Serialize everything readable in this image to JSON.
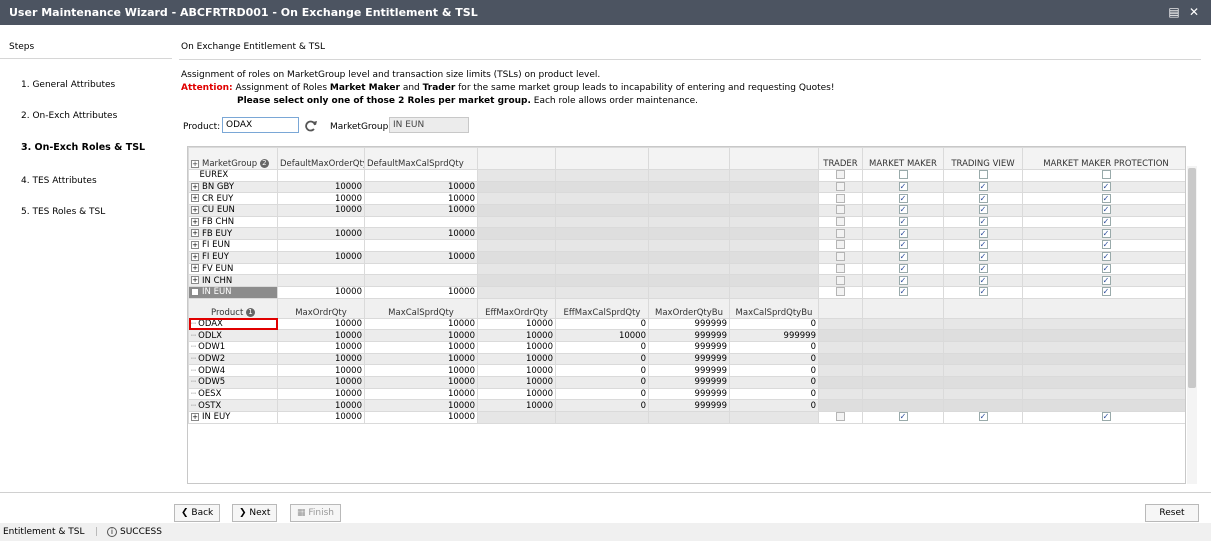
{
  "window": {
    "title": "User Maintenance Wizard  - ABCFRTRD001 - On Exchange Entitlement & TSL"
  },
  "steps": {
    "header": "Steps",
    "items": [
      "1. General Attributes",
      "2. On-Exch Attributes",
      "3. On-Exch Roles & TSL",
      "4. TES Attributes",
      "5. TES Roles & TSL"
    ],
    "active_index": 2
  },
  "section": {
    "title": "On Exchange Entitlement & TSL",
    "info_line1": "Assignment of roles on MarketGroup level and transaction size limits (TSLs) on product level.",
    "attention_label": "Attention:",
    "info_line2_a": "Assignment of Roles ",
    "info_line2_b": "Market Maker",
    "info_line2_c": " and ",
    "info_line2_d": "Trader",
    "info_line2_e": " for the same market group leads to incapability of entering and requesting Quotes!",
    "info_line3_bold": "Please select only one of those 2 Roles per market group.",
    "info_line3_rest": " Each role allows order maintenance."
  },
  "filters": {
    "product_label": "Product:",
    "product_value": "ODAX",
    "marketgroup_label": "MarketGroup:",
    "marketgroup_value": "IN EUN"
  },
  "grid": {
    "headers": [
      "MarketGroup",
      "DefaultMaxOrderQty",
      "DefaultMaxCalSprdQty",
      "",
      "",
      "",
      "",
      "TRADER",
      "MARKET MAKER",
      "TRADING VIEW",
      "MARKET MAKER PROTECTION"
    ],
    "marketgroup_sort_badge": "2",
    "rows_top": [
      {
        "name": "EUREX",
        "q1": "",
        "q2": "",
        "expander": false,
        "roles": [
          false,
          false,
          false,
          false
        ],
        "checks_shown": true
      },
      {
        "name": "BN GBY",
        "q1": "10000",
        "q2": "10000",
        "expander": true,
        "roles": [
          false,
          true,
          true,
          true
        ],
        "checks_shown": true
      },
      {
        "name": "CR EUY",
        "q1": "10000",
        "q2": "10000",
        "expander": true,
        "roles": [
          false,
          true,
          true,
          true
        ],
        "checks_shown": true
      },
      {
        "name": "CU EUN",
        "q1": "10000",
        "q2": "10000",
        "expander": true,
        "roles": [
          false,
          true,
          true,
          true
        ],
        "checks_shown": true
      },
      {
        "name": "FB CHN",
        "q1": "",
        "q2": "",
        "expander": true,
        "roles": [
          false,
          true,
          true,
          true
        ],
        "checks_shown": true
      },
      {
        "name": "FB EUY",
        "q1": "10000",
        "q2": "10000",
        "expander": true,
        "roles": [
          false,
          true,
          true,
          true
        ],
        "checks_shown": true
      },
      {
        "name": "FI EUN",
        "q1": "",
        "q2": "",
        "expander": true,
        "roles": [
          false,
          true,
          true,
          true
        ],
        "checks_shown": true
      },
      {
        "name": "FI EUY",
        "q1": "10000",
        "q2": "10000",
        "expander": true,
        "roles": [
          false,
          true,
          true,
          true
        ],
        "checks_shown": true
      },
      {
        "name": "FV EUN",
        "q1": "",
        "q2": "",
        "expander": true,
        "roles": [
          false,
          true,
          true,
          true
        ],
        "checks_shown": true
      },
      {
        "name": "IN CHN",
        "q1": "",
        "q2": "",
        "expander": true,
        "roles": [
          false,
          true,
          true,
          true
        ],
        "checks_shown": true
      },
      {
        "name": "IN EUN",
        "q1": "10000",
        "q2": "10000",
        "expander": true,
        "expanded": true,
        "roles": [
          false,
          true,
          true,
          true
        ],
        "checks_shown": true
      }
    ],
    "sub_headers": [
      "Product",
      "MaxOrdrQty",
      "MaxCalSprdQty",
      "EffMaxOrdrQty",
      "EffMaxCalSprdQty",
      "MaxOrderQtyBu",
      "MaxCalSprdQtyBu"
    ],
    "product_sort_badge": "1",
    "products": [
      {
        "p": "ODAX",
        "v": [
          "10000",
          "10000",
          "10000",
          "0",
          "999999",
          "0"
        ]
      },
      {
        "p": "ODLX",
        "v": [
          "10000",
          "10000",
          "10000",
          "10000",
          "999999",
          "999999"
        ]
      },
      {
        "p": "ODW1",
        "v": [
          "10000",
          "10000",
          "10000",
          "0",
          "999999",
          "0"
        ]
      },
      {
        "p": "ODW2",
        "v": [
          "10000",
          "10000",
          "10000",
          "0",
          "999999",
          "0"
        ]
      },
      {
        "p": "ODW4",
        "v": [
          "10000",
          "10000",
          "10000",
          "0",
          "999999",
          "0"
        ]
      },
      {
        "p": "ODW5",
        "v": [
          "10000",
          "10000",
          "10000",
          "0",
          "999999",
          "0"
        ]
      },
      {
        "p": "OESX",
        "v": [
          "10000",
          "10000",
          "10000",
          "0",
          "999999",
          "0"
        ]
      },
      {
        "p": "OSTX",
        "v": [
          "10000",
          "10000",
          "10000",
          "0",
          "999999",
          "0"
        ]
      }
    ],
    "rows_bottom": [
      {
        "name": "IN EUY",
        "q1": "10000",
        "q2": "10000",
        "expander": true,
        "roles": [
          false,
          true,
          true,
          true
        ],
        "checks_shown": true
      }
    ]
  },
  "buttons": {
    "back": "Back",
    "next": "Next",
    "finish": "Finish",
    "reset": "Reset"
  },
  "status": {
    "left": "Entitlement & TSL",
    "result": "SUCCESS"
  }
}
